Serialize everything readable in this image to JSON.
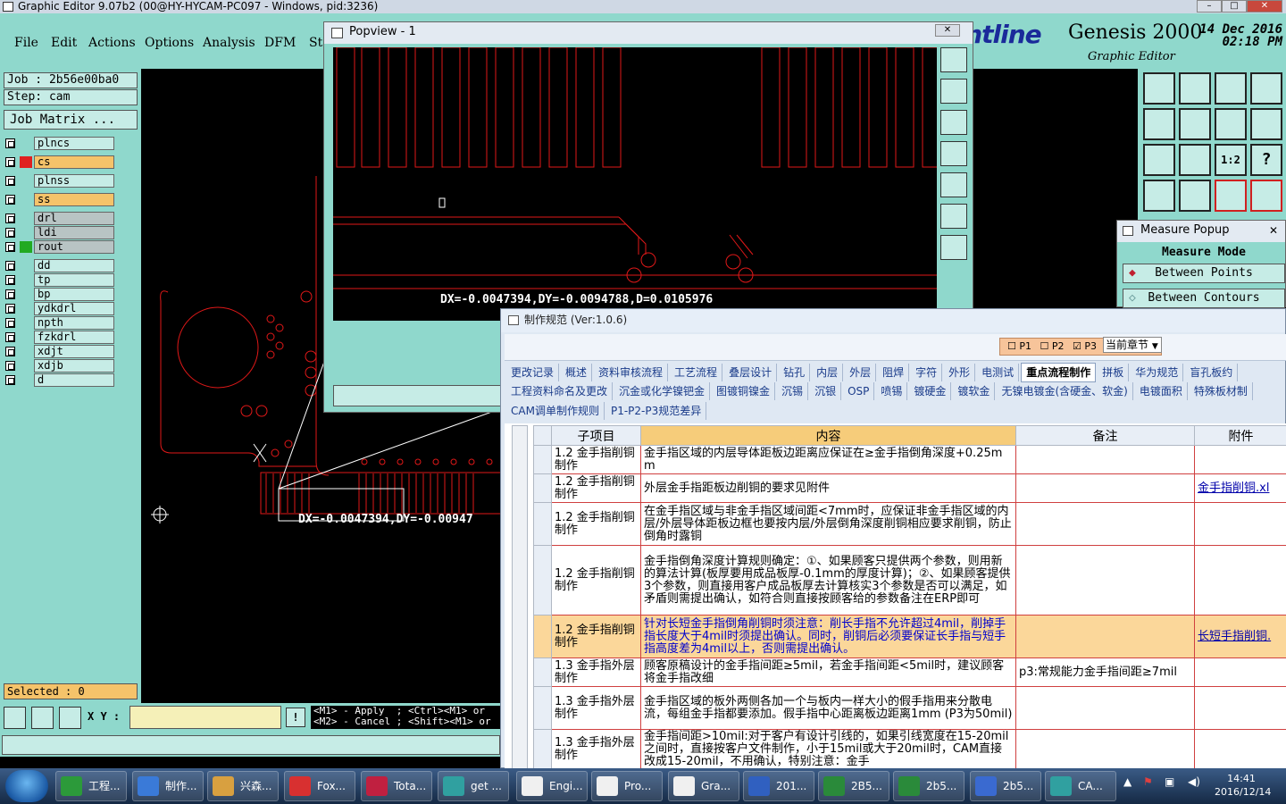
{
  "window": {
    "title": "Graphic Editor 9.07b2 (00@HY-HYCAM-PC097 - Windows, pid:3236)"
  },
  "menu": [
    {
      "label": "File"
    },
    {
      "label": "Edit"
    },
    {
      "label": "Actions"
    },
    {
      "label": "Options"
    },
    {
      "label": "Analysis"
    },
    {
      "label": "DFM"
    },
    {
      "label": "Ste"
    }
  ],
  "brand": {
    "logo": "ontline",
    "product": "Genesis 2000",
    "subtitle": "Graphic Editor",
    "date": "14 Dec 2016",
    "time": "02:18 PM"
  },
  "job": {
    "job": "Job  : 2b56e00ba0",
    "step": "Step: cam",
    "matrix": "Job Matrix ..."
  },
  "layers": [
    {
      "name": "plncs",
      "color": ""
    },
    {
      "name": "cs",
      "color": "#e02020",
      "active": true
    },
    {
      "name": "plnss",
      "color": ""
    },
    {
      "name": "ss",
      "color": "",
      "active": true
    },
    {
      "name": "drl",
      "color": "",
      "gray": true
    },
    {
      "name": "ldi",
      "color": "",
      "gray": true
    },
    {
      "name": "rout",
      "color": "#22aa22",
      "gray": true
    },
    {
      "name": "dd",
      "color": ""
    },
    {
      "name": "tp",
      "color": ""
    },
    {
      "name": "bp",
      "color": ""
    },
    {
      "name": "ydkdrl",
      "color": ""
    },
    {
      "name": "npth",
      "color": ""
    },
    {
      "name": "fzkdrl",
      "color": ""
    },
    {
      "name": "xdjt",
      "color": ""
    },
    {
      "name": "xdjb",
      "color": ""
    },
    {
      "name": "d",
      "color": ""
    }
  ],
  "selected": "Selected : 0",
  "xy_label": "X Y :",
  "hint": "<M1> - Apply  ; <Ctrl><M1> or\n<M2> - Cancel ; <Shift><M1> or",
  "canvas_measure": "DX=-0.0047394,DY=-0.00947",
  "popview": {
    "title": "Popview - 1",
    "measure": "DX=-0.0047394,DY=-0.0094788,D=0.0105976",
    "marker": "0"
  },
  "measure_popup": {
    "title": "Measure Popup",
    "header": "Measure Mode",
    "opt1": "Between Points",
    "opt2": "Between Contours"
  },
  "spec": {
    "title": "制作规范 (Ver:1.0.6)",
    "p1": "P1",
    "p2": "P2",
    "p3": "P3",
    "chapter": "当前章节",
    "tabs_row1": [
      "更改记录",
      "概述",
      "资料审核流程",
      "工艺流程",
      "叠层设计",
      "钻孔",
      "内层",
      "外层",
      "阻焊",
      "字符",
      "外形",
      "电测试",
      "重点流程制作",
      "拼板",
      "华为规范",
      "盲孔板约"
    ],
    "active_tab": "重点流程制作",
    "tabs_row2": [
      "工程资料命名及更改",
      "沉金或化学镍钯金",
      "图镀铜镍金",
      "沉锡",
      "沉银",
      "OSP",
      "喷锡",
      "镀硬金",
      "镀软金",
      "无镍电镀金(含硬金、软金)",
      "电镀面积",
      "特殊板材制"
    ],
    "tabs_row3": [
      "CAM调单制作规则",
      "P1-P2-P3规范差异"
    ],
    "columns": [
      "子项目",
      "内容",
      "备注",
      "附件"
    ],
    "rows": [
      {
        "sub": "1.2 金手指削铜制作",
        "content": "金手指区域的内层导体距板边距离应保证在≥金手指倒角深度+0.25mm",
        "note": "",
        "att": ""
      },
      {
        "sub": "1.2 金手指削铜制作",
        "content": "外层金手指距板边削铜的要求见附件",
        "note": "",
        "att": "金手指削铜.xl"
      },
      {
        "sub": "1.2 金手指削铜制作",
        "content": "在金手指区域与非金手指区域间距<7mm时，应保证非金手指区域的内层/外层导体距板边框也要按内层/外层倒角深度削铜相应要求削铜，防止倒角时露铜",
        "note": "",
        "att": ""
      },
      {
        "sub": "1.2 金手指削铜制作",
        "content": "金手指倒角深度计算规则确定：①、如果顾客只提供两个参数，则用新的算法计算(板厚要用成品板厚-0.1mm的厚度计算)；②、如果顾客提供3个参数，则直接用客户成品板厚去计算核实3个参数是否可以满足，如矛盾则需提出确认，如符合则直接按顾客给的参数备注在ERP即可",
        "note": "",
        "att": ""
      },
      {
        "sub": "1.2 金手指削铜制作",
        "content": "针对长短金手指倒角削铜时须注意：削长手指不允许超过4mil，削掉手指长度大于4mil时须提出确认。同时，削铜后必须要保证长手指与短手指高度差为4mil以上，否则需提出确认。",
        "note": "",
        "att": "长短手指削铜.",
        "hi": true
      },
      {
        "sub": "1.3 金手指外层制作",
        "content": "顾客原稿设计的金手指间距≥5mil，若金手指间距<5mil时，建议顾客将金手指改细",
        "note": "p3:常规能力金手指间距≥7mil",
        "att": ""
      },
      {
        "sub": "1.3 金手指外层制作",
        "content": "金手指区域的板外两侧各加一个与板内一样大小的假手指用来分散电流，每组金手指都要添加。假手指中心距离板边距离1mm (P3为50mil)",
        "note": "",
        "att": ""
      },
      {
        "sub": "1.3 金手指外层制作",
        "content": "金手指间距>10mil:对于客户有设计引线的，如果引线宽度在15-20mil之间时，直接按客户文件制作，小于15mil或大于20mil时，CAM直接改成15-20mil，不用确认，特别注意：金手",
        "note": "",
        "att": ""
      }
    ]
  },
  "taskbar": [
    {
      "label": "工程...",
      "color": "#2c9a3a"
    },
    {
      "label": "制作...",
      "color": "#3a7ad8"
    },
    {
      "label": "兴森...",
      "color": "#d8a040"
    },
    {
      "label": "Fox...",
      "color": "#d83030"
    },
    {
      "label": "Tota...",
      "color": "#c02040"
    },
    {
      "label": "get ...",
      "color": "#30a0a0"
    },
    {
      "label": "Engi...",
      "color": "#f0f0f0"
    },
    {
      "label": "Pro...",
      "color": "#f0f0f0"
    },
    {
      "label": "Gra...",
      "color": "#f0f0f0"
    },
    {
      "label": "201...",
      "color": "#3060c0"
    },
    {
      "label": "2B5...",
      "color": "#2a8a3a"
    },
    {
      "label": "2b5...",
      "color": "#2a8a3a"
    },
    {
      "label": "2b5...",
      "color": "#3a6ad0"
    },
    {
      "label": "CA...",
      "color": "#30a0a0"
    }
  ],
  "clock": {
    "time": "14:41",
    "date": "2016/12/14"
  }
}
